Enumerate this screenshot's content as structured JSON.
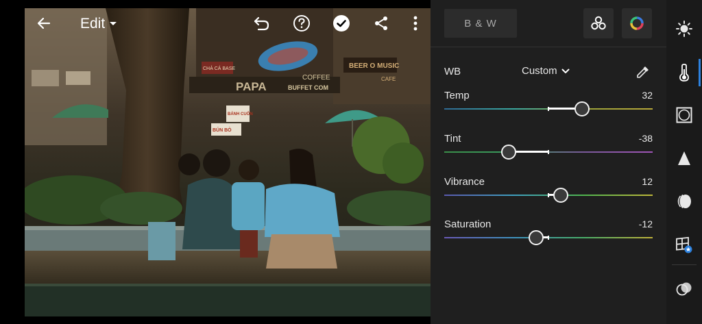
{
  "header": {
    "edit_label": "Edit"
  },
  "photo": {
    "signs": {
      "papa": "PAPA",
      "coffee": "COFFEE",
      "buffet": "BUFFET COM",
      "beer": "BEER O MUSIC",
      "cafe": "CAFE",
      "com_ga": "CHẢ CÁ BASE",
      "banh_cuon": "BÁNH CUỐN",
      "bun_bo": "BÚN BÒ"
    }
  },
  "panel": {
    "bw_label": "B & W",
    "wb_label": "WB",
    "wb_mode": "Custom",
    "sliders": [
      {
        "key": "temp",
        "label": "Temp",
        "value_text": "32",
        "value": 32,
        "min": -100,
        "max": 100,
        "gradient": [
          "#2f6b95",
          "#3aa9a0",
          "#9aa23a",
          "#b8a83a"
        ]
      },
      {
        "key": "tint",
        "label": "Tint",
        "value_text": "-38",
        "value": -38,
        "min": -100,
        "max": 100,
        "gradient": [
          "#3a8f4a",
          "#3a9c60",
          "#7a5a9a",
          "#a155b8"
        ]
      },
      {
        "key": "vibrance",
        "label": "Vibrance",
        "value_text": "12",
        "value": 12,
        "min": -100,
        "max": 100,
        "gradient": [
          "#5a5ab0",
          "#3fa0c0",
          "#4fb54f",
          "#c0b83a"
        ]
      },
      {
        "key": "saturation",
        "label": "Saturation",
        "value_text": "-12",
        "value": -12,
        "min": -100,
        "max": 100,
        "gradient": [
          "#6a5ab8",
          "#3f93c0",
          "#48b06a",
          "#c2b43a"
        ]
      }
    ]
  },
  "colors": {
    "panel_bg": "#1f1f1f",
    "accent": "#2d82e0"
  },
  "rail": {
    "items": [
      "light-icon",
      "color-thermometer-icon",
      "vignette-icon",
      "detail-icon",
      "optics-icon",
      "geometry-icon",
      "presets-icon"
    ],
    "active": "color-thermometer-icon"
  }
}
